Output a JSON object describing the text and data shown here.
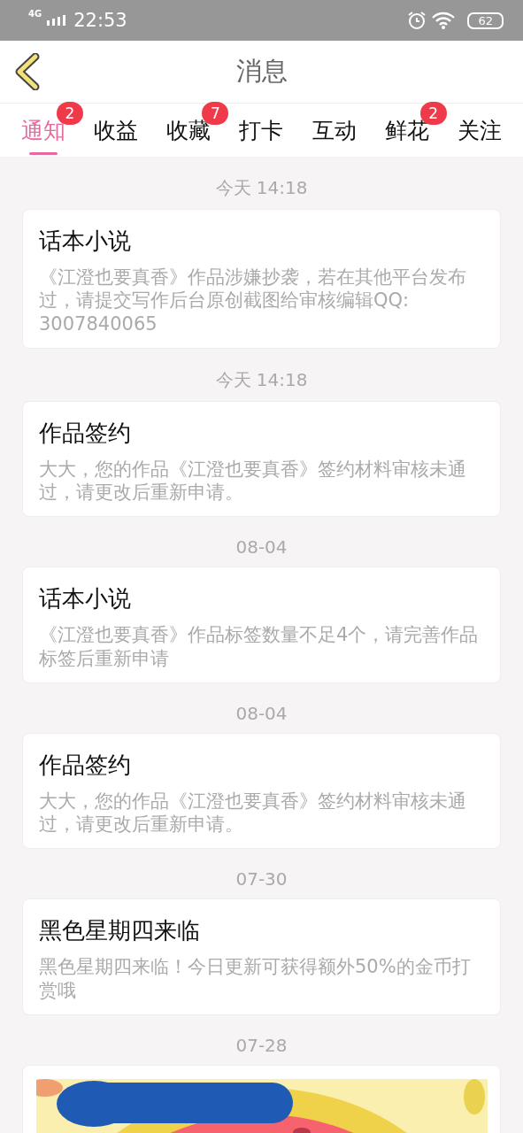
{
  "status_bar": {
    "network": "4G",
    "time": "22:53",
    "battery": "62"
  },
  "header": {
    "title": "消息"
  },
  "tabs": [
    {
      "label": "通知",
      "selected": true,
      "badge": "2"
    },
    {
      "label": "收益",
      "selected": false
    },
    {
      "label": "收藏",
      "selected": false,
      "badge": "7"
    },
    {
      "label": "打卡",
      "selected": false
    },
    {
      "label": "互动",
      "selected": false
    },
    {
      "label": "鲜花",
      "selected": false,
      "badge": "2"
    },
    {
      "label": "关注",
      "selected": false
    }
  ],
  "messages": [
    {
      "kind": "text",
      "date": "今天 14:18",
      "title": "话本小说",
      "body": "《江澄也要真香》作品涉嫌抄袭，若在其他平台发布过，请提交写作后台原创截图给审核编辑QQ: 3007840065"
    },
    {
      "kind": "text",
      "date": "今天 14:18",
      "title": "作品签约",
      "body": "大大，您的作品《江澄也要真香》签约材料审核未通过，请更改后重新申请。"
    },
    {
      "kind": "text",
      "date": "08-04",
      "title": "话本小说",
      "body": "《江澄也要真香》作品标签数量不足4个，请完善作品标签后重新申请"
    },
    {
      "kind": "text",
      "date": "08-04",
      "title": "作品签约",
      "body": "大大，您的作品《江澄也要真香》签约材料审核未通过，请更改后重新申请。"
    },
    {
      "kind": "text",
      "date": "07-30",
      "title": "黑色星期四来临",
      "body": "黑色星期四来临！今日更新可获得额外50%的金币打赏哦"
    },
    {
      "kind": "picture",
      "date": "07-28"
    }
  ]
}
